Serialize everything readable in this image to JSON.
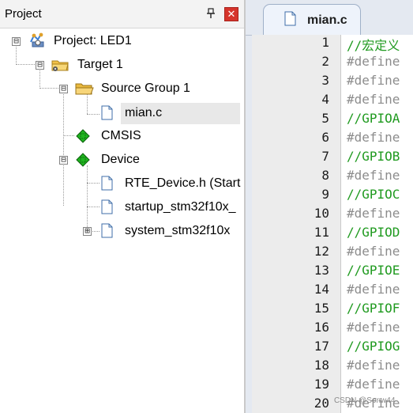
{
  "project_panel": {
    "title": "Project",
    "pin_icon": "pin-icon",
    "close_icon": "close-icon",
    "tree": [
      {
        "label": "Project: LED1",
        "icon": "project-icon",
        "expander": "⊟"
      },
      {
        "label": "Target 1",
        "icon": "target-folder-icon",
        "expander": "⊟"
      },
      {
        "label": "Source Group 1",
        "icon": "folder-icon",
        "expander": "⊟"
      },
      {
        "label": "mian.c",
        "icon": "file-icon",
        "selected": true
      },
      {
        "label": "CMSIS",
        "icon": "component-icon"
      },
      {
        "label": "Device",
        "icon": "component-icon",
        "expander": "⊟"
      },
      {
        "label": "RTE_Device.h (Start",
        "icon": "file-icon"
      },
      {
        "label": "startup_stm32f10x_",
        "icon": "file-icon"
      },
      {
        "label": "system_stm32f10x",
        "icon": "file-icon",
        "expander": "⊞"
      }
    ]
  },
  "editor": {
    "tab_label": "mian.c",
    "lines": [
      {
        "n": "1",
        "text": "//宏定义",
        "kind": "comment"
      },
      {
        "n": "2",
        "text": "#define",
        "kind": "directive"
      },
      {
        "n": "3",
        "text": "#define",
        "kind": "directive"
      },
      {
        "n": "4",
        "text": "#define",
        "kind": "directive"
      },
      {
        "n": "5",
        "text": "//GPIOA",
        "kind": "comment"
      },
      {
        "n": "6",
        "text": "#define",
        "kind": "directive"
      },
      {
        "n": "7",
        "text": "//GPIOB",
        "kind": "comment"
      },
      {
        "n": "8",
        "text": "#define",
        "kind": "directive"
      },
      {
        "n": "9",
        "text": "//GPIOC",
        "kind": "comment"
      },
      {
        "n": "10",
        "text": "#define",
        "kind": "directive"
      },
      {
        "n": "11",
        "text": "//GPIOD",
        "kind": "comment"
      },
      {
        "n": "12",
        "text": "#define",
        "kind": "directive"
      },
      {
        "n": "13",
        "text": "//GPIOE",
        "kind": "comment"
      },
      {
        "n": "14",
        "text": "#define",
        "kind": "directive"
      },
      {
        "n": "15",
        "text": "//GPIOF",
        "kind": "comment"
      },
      {
        "n": "16",
        "text": "#define",
        "kind": "directive"
      },
      {
        "n": "17",
        "text": "//GPIOG",
        "kind": "comment"
      },
      {
        "n": "18",
        "text": "#define",
        "kind": "directive"
      },
      {
        "n": "19",
        "text": "#define",
        "kind": "directive"
      },
      {
        "n": "20",
        "text": "#define",
        "kind": "directive"
      }
    ]
  },
  "watermark": "CSDN @Sonw44"
}
